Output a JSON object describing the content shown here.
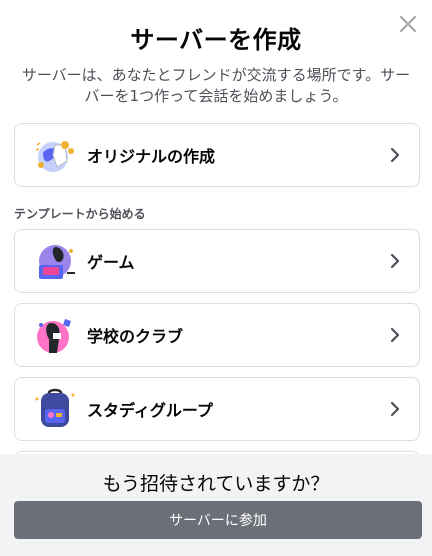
{
  "modal": {
    "title": "サーバーを作成",
    "subtitle": "サーバーは、あなたとフレンドが交流する場所です。サーバーを1つ作って会話を始めましょう。"
  },
  "options": {
    "create_own": {
      "label": "オリジナルの作成",
      "icon": "globe-icon"
    },
    "section_label": "テンプレートから始める",
    "templates": [
      {
        "label": "ゲーム",
        "icon": "gaming-icon"
      },
      {
        "label": "学校のクラブ",
        "icon": "school-club-icon"
      },
      {
        "label": "スタディグループ",
        "icon": "study-group-backpack-icon"
      }
    ]
  },
  "footer": {
    "question": "もう招待されていますか？",
    "join_label": "サーバーに参加"
  },
  "colors": {
    "button_bg": "#6d6f78",
    "footer_bg": "#f2f3f5",
    "border": "#dcdde1"
  }
}
